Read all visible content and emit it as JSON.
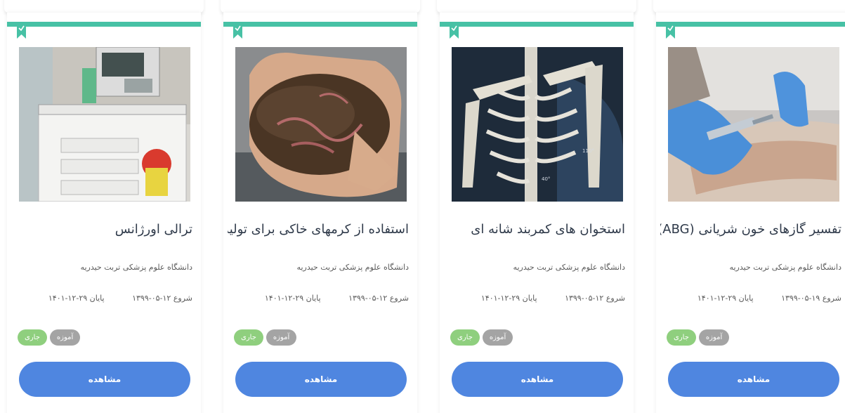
{
  "colors": {
    "accent_bar": "#47c1a5",
    "button": "#4f86e0",
    "badge_current": "#8fcf7e",
    "badge_type": "#a4a4a4"
  },
  "courses": [
    {
      "title": "ترالی اورژانس",
      "organization": "دانشگاه علوم پزشکی تربت حیدریه",
      "start": "شروع ۱۲-۰۵-۱۳۹۹",
      "end": "پایان ۲۹-۱۲-۱۴۰۱",
      "badge_current": "جاری",
      "badge_type": "آموزه",
      "button": "مشاهده",
      "image": "emergency-trolley-photo",
      "bookmark_icon": "bookmark-icon"
    },
    {
      "title": "استفاده از کرمهای خاکی برای تولید...",
      "organization": "دانشگاه علوم پزشکی تربت حیدریه",
      "start": "شروع ۱۲-۰۵-۱۳۹۹",
      "end": "پایان ۲۹-۱۲-۱۴۰۱",
      "badge_current": "جاری",
      "badge_type": "آموزه",
      "button": "مشاهده",
      "image": "earthworms-soil-photo",
      "bookmark_icon": "bookmark-icon"
    },
    {
      "title": "استخوان های کمربند شانه ای",
      "organization": "دانشگاه علوم پزشکی تربت حیدریه",
      "start": "شروع ۱۲-۰۵-۱۳۹۹",
      "end": "پایان ۲۹-۱۲-۱۴۰۱",
      "badge_current": "جاری",
      "badge_type": "آموزه",
      "button": "مشاهده",
      "image": "shoulder-girdle-skeleton-render",
      "bookmark_icon": "bookmark-icon"
    },
    {
      "title": "تفسیر گازهای خون شریانی (ABG)",
      "organization": "دانشگاه علوم پزشکی تربت حیدریه",
      "start": "شروع ۱۹-۰۵-۱۳۹۹",
      "end": "پایان ۲۹-۱۲-۱۴۰۱",
      "badge_current": "جاری",
      "badge_type": "آموزه",
      "button": "مشاهده",
      "image": "arterial-blood-sampling-photo",
      "bookmark_icon": "bookmark-icon"
    }
  ]
}
